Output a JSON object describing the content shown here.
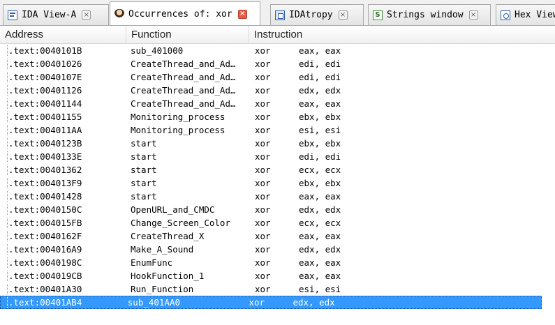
{
  "tabs": [
    {
      "label": "IDA View-A",
      "icon": "ida-view-icon",
      "close": "×",
      "active": false
    },
    {
      "label": "Occurrences of: xor",
      "icon": "occurrences-icon",
      "close": "×",
      "active": true
    },
    {
      "label": "IDAtropy",
      "icon": "idatropy-icon",
      "close": "×",
      "active": false
    },
    {
      "label": "Strings window",
      "icon": "strings-icon",
      "close": "×",
      "active": false
    },
    {
      "label": "Hex View",
      "icon": "hex-view-icon",
      "close": "×",
      "active": false
    }
  ],
  "strings_icon_glyph": "S",
  "columns": {
    "address": "Address",
    "function": "Function",
    "instruction": "Instruction"
  },
  "rows": [
    {
      "address": ".text:0040101B",
      "function": "sub_401000",
      "mnemonic": "xor",
      "operands": "eax, eax"
    },
    {
      "address": ".text:00401026",
      "function": "CreateThread_and_Ad…",
      "mnemonic": "xor",
      "operands": "edi, edi"
    },
    {
      "address": ".text:0040107E",
      "function": "CreateThread_and_Ad…",
      "mnemonic": "xor",
      "operands": "edi, edi"
    },
    {
      "address": ".text:00401126",
      "function": "CreateThread_and_Ad…",
      "mnemonic": "xor",
      "operands": "edx, edx"
    },
    {
      "address": ".text:00401144",
      "function": "CreateThread_and_Ad…",
      "mnemonic": "xor",
      "operands": "eax, eax"
    },
    {
      "address": ".text:00401155",
      "function": "Monitoring_process",
      "mnemonic": "xor",
      "operands": "ebx, ebx"
    },
    {
      "address": ".text:004011AA",
      "function": "Monitoring_process",
      "mnemonic": "xor",
      "operands": "esi, esi"
    },
    {
      "address": ".text:0040123B",
      "function": "start",
      "mnemonic": "xor",
      "operands": "ebx, ebx"
    },
    {
      "address": ".text:0040133E",
      "function": "start",
      "mnemonic": "xor",
      "operands": "edi, edi"
    },
    {
      "address": ".text:00401362",
      "function": "start",
      "mnemonic": "xor",
      "operands": "ecx, ecx"
    },
    {
      "address": ".text:004013F9",
      "function": "start",
      "mnemonic": "xor",
      "operands": "ebx, ebx"
    },
    {
      "address": ".text:00401428",
      "function": "start",
      "mnemonic": "xor",
      "operands": "eax, eax"
    },
    {
      "address": ".text:0040150C",
      "function": "OpenURL_and_CMDC",
      "mnemonic": "xor",
      "operands": "edx, edx"
    },
    {
      "address": ".text:004015FB",
      "function": "Change_Screen_Color",
      "mnemonic": "xor",
      "operands": "ecx, ecx"
    },
    {
      "address": ".text:0040162F",
      "function": "CreateThread_X",
      "mnemonic": "xor",
      "operands": "eax, eax"
    },
    {
      "address": ".text:004016A9",
      "function": "Make_A_Sound",
      "mnemonic": "xor",
      "operands": "edx, edx"
    },
    {
      "address": ".text:0040198C",
      "function": "EnumFunc",
      "mnemonic": "xor",
      "operands": "eax, eax"
    },
    {
      "address": ".text:004019CB",
      "function": "HookFunction_1",
      "mnemonic": "xor",
      "operands": "eax, eax"
    },
    {
      "address": ".text:00401A30",
      "function": "Run_Function",
      "mnemonic": "xor",
      "operands": "esi, esi"
    },
    {
      "address": ".text:00401AB4",
      "function": "sub_401AA0",
      "mnemonic": "xor",
      "operands": "edx, edx",
      "selected": true
    }
  ],
  "colors": {
    "selection": "#3399ff",
    "active_close": "#e85c44"
  }
}
